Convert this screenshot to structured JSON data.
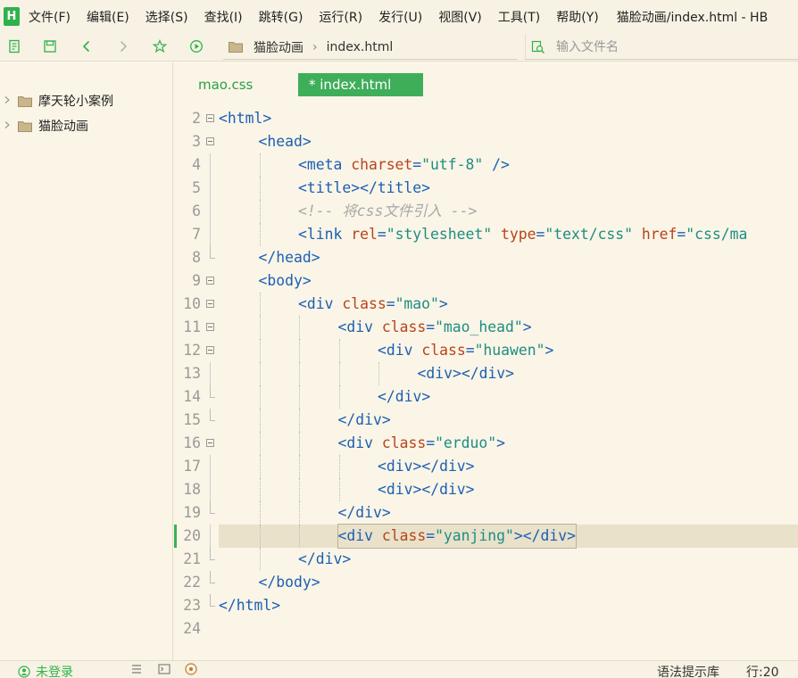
{
  "app": {
    "logo_letter": "H",
    "window_title": "猫脸动画/index.html - HB"
  },
  "menu": [
    "文件(F)",
    "编辑(E)",
    "选择(S)",
    "查找(I)",
    "跳转(G)",
    "运行(R)",
    "发行(U)",
    "视图(V)",
    "工具(T)",
    "帮助(Y)"
  ],
  "toolbar": {
    "breadcrumb": [
      "猫脸动画",
      "index.html"
    ],
    "search_placeholder": "输入文件名",
    "colors": {
      "icon_green": "#2fb24c",
      "icon_gray": "#b5b5b5"
    }
  },
  "sidebar": {
    "items": [
      {
        "label": "摩天轮小案例",
        "icon": "folder-icon"
      },
      {
        "label": "猫脸动画",
        "icon": "folder-icon"
      }
    ]
  },
  "tabs": [
    {
      "label": "mao.css",
      "active": false
    },
    {
      "label": "* index.html",
      "active": true
    }
  ],
  "editor": {
    "active_line": 20,
    "lines": [
      {
        "num": "2",
        "indent": 0,
        "fold": "open",
        "tokens": [
          [
            "t-tag",
            "<html>"
          ]
        ]
      },
      {
        "num": "3",
        "indent": 1,
        "fold": "open",
        "tokens": [
          [
            "t-tag",
            "<head>"
          ]
        ]
      },
      {
        "num": "4",
        "indent": 2,
        "fold": "line",
        "tokens": [
          [
            "t-tag",
            "<meta "
          ],
          [
            "t-attr",
            "charset"
          ],
          [
            "t-tag",
            "="
          ],
          [
            "t-str",
            "\"utf-8\""
          ],
          [
            "t-tag",
            " />"
          ]
        ]
      },
      {
        "num": "5",
        "indent": 2,
        "fold": "line",
        "tokens": [
          [
            "t-tag",
            "<title></title>"
          ]
        ]
      },
      {
        "num": "6",
        "indent": 2,
        "fold": "line",
        "tokens": [
          [
            "t-com",
            "<!-- 将css文件引入 -->"
          ]
        ]
      },
      {
        "num": "7",
        "indent": 2,
        "fold": "line",
        "tokens": [
          [
            "t-tag",
            "<link "
          ],
          [
            "t-attr",
            "rel"
          ],
          [
            "t-tag",
            "="
          ],
          [
            "t-str",
            "\"stylesheet\""
          ],
          [
            "t-tag",
            " "
          ],
          [
            "t-attr",
            "type"
          ],
          [
            "t-tag",
            "="
          ],
          [
            "t-str",
            "\"text/css\""
          ],
          [
            "t-tag",
            " "
          ],
          [
            "t-attr",
            "href"
          ],
          [
            "t-tag",
            "="
          ],
          [
            "t-str",
            "\"css/ma"
          ]
        ]
      },
      {
        "num": "8",
        "indent": 1,
        "fold": "end",
        "tokens": [
          [
            "t-tag",
            "</head>"
          ]
        ]
      },
      {
        "num": "9",
        "indent": 1,
        "fold": "open",
        "tokens": [
          [
            "t-tag",
            "<body>"
          ]
        ]
      },
      {
        "num": "10",
        "indent": 2,
        "fold": "open",
        "tokens": [
          [
            "t-tag",
            "<div "
          ],
          [
            "t-attr",
            "class"
          ],
          [
            "t-tag",
            "="
          ],
          [
            "t-str",
            "\"mao\""
          ],
          [
            "t-tag",
            ">"
          ]
        ]
      },
      {
        "num": "11",
        "indent": 3,
        "fold": "open",
        "tokens": [
          [
            "t-tag",
            "<div "
          ],
          [
            "t-attr",
            "class"
          ],
          [
            "t-tag",
            "="
          ],
          [
            "t-str",
            "\"mao_head\""
          ],
          [
            "t-tag",
            ">"
          ]
        ]
      },
      {
        "num": "12",
        "indent": 4,
        "fold": "open",
        "tokens": [
          [
            "t-tag",
            "<div "
          ],
          [
            "t-attr",
            "class"
          ],
          [
            "t-tag",
            "="
          ],
          [
            "t-str",
            "\"huawen\""
          ],
          [
            "t-tag",
            ">"
          ]
        ]
      },
      {
        "num": "13",
        "indent": 5,
        "fold": "line",
        "tokens": [
          [
            "t-tag",
            "<div></div>"
          ]
        ]
      },
      {
        "num": "14",
        "indent": 4,
        "fold": "end",
        "tokens": [
          [
            "t-tag",
            "</div>"
          ]
        ]
      },
      {
        "num": "15",
        "indent": 3,
        "fold": "end",
        "tokens": [
          [
            "t-tag",
            "</div>"
          ]
        ]
      },
      {
        "num": "16",
        "indent": 3,
        "fold": "open",
        "tokens": [
          [
            "t-tag",
            "<div "
          ],
          [
            "t-attr",
            "class"
          ],
          [
            "t-tag",
            "="
          ],
          [
            "t-str",
            "\"erduo\""
          ],
          [
            "t-tag",
            ">"
          ]
        ]
      },
      {
        "num": "17",
        "indent": 4,
        "fold": "line",
        "tokens": [
          [
            "t-tag",
            "<div></div>"
          ]
        ]
      },
      {
        "num": "18",
        "indent": 4,
        "fold": "line",
        "tokens": [
          [
            "t-tag",
            "<div></div>"
          ]
        ]
      },
      {
        "num": "19",
        "indent": 3,
        "fold": "end",
        "tokens": [
          [
            "t-tag",
            "</div>"
          ]
        ]
      },
      {
        "num": "20",
        "indent": 3,
        "fold": "line",
        "tokens": [
          [
            "t-tag",
            "<div "
          ],
          [
            "t-attr",
            "class"
          ],
          [
            "t-tag",
            "="
          ],
          [
            "t-str",
            "\"yanjing\""
          ],
          [
            "t-tag",
            "></div>"
          ]
        ]
      },
      {
        "num": "21",
        "indent": 2,
        "fold": "end",
        "tokens": [
          [
            "t-tag",
            "</div>"
          ]
        ]
      },
      {
        "num": "22",
        "indent": 1,
        "fold": "end",
        "tokens": [
          [
            "t-tag",
            "</body>"
          ]
        ]
      },
      {
        "num": "23",
        "indent": 0,
        "fold": "end",
        "tokens": [
          [
            "t-tag",
            "</html>"
          ]
        ]
      },
      {
        "num": "24",
        "indent": 0,
        "fold": "none",
        "tokens": []
      }
    ]
  },
  "statusbar": {
    "login": "未登录",
    "syntax_hint": "语法提示库",
    "cursor": "行:20"
  }
}
